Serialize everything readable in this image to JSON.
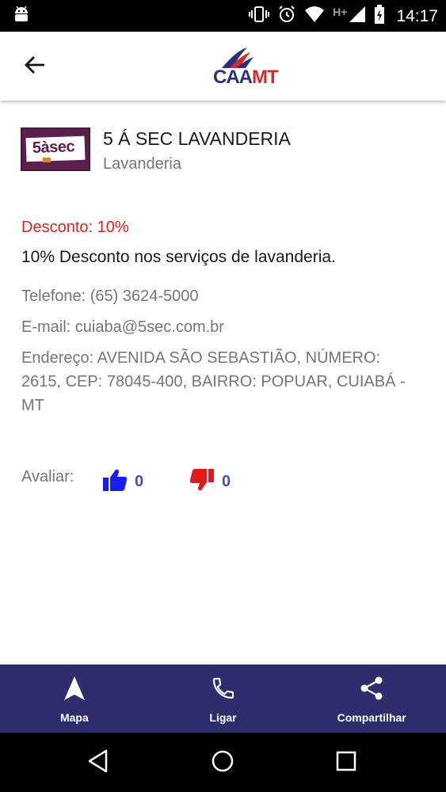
{
  "status_bar": {
    "time": "14:17",
    "network_label": "H+",
    "icons": [
      "android-icon",
      "vibrate-icon",
      "alarm-icon",
      "wifi-icon",
      "signal-icon",
      "battery-charging-icon"
    ]
  },
  "app_bar": {
    "logo_caa": "CAA",
    "logo_mt": "MT",
    "back_icon": "arrow-back-icon"
  },
  "partner": {
    "logo_text": "5àsec",
    "name": "5 Á SEC LAVANDERIA",
    "category": "Lavanderia",
    "discount": "Desconto: 10%",
    "description": "10% Desconto nos serviços de lavanderia.",
    "phone": "Telefone: (65) 3624-5000",
    "email": "E-mail: cuiaba@5sec.com.br",
    "address": "Endereço: AVENIDA SÃO SEBASTIÃO, NÚMERO: 2615, CEP: 78045-400, BAIRRO: POPUAR, CUIABÁ - MT"
  },
  "rating": {
    "label": "Avaliar:",
    "likes": "0",
    "dislikes": "0"
  },
  "actions": [
    {
      "label": "Mapa",
      "icon": "navigation-icon"
    },
    {
      "label": "Ligar",
      "icon": "phone-icon"
    },
    {
      "label": "Compartilhar",
      "icon": "share-icon"
    }
  ],
  "colors": {
    "accent_red": "#e02020",
    "action_bar": "#2e2e6e",
    "count_blue": "#3f51b5",
    "like_blue": "#1a1aff",
    "dislike_red": "#e21a1a"
  }
}
